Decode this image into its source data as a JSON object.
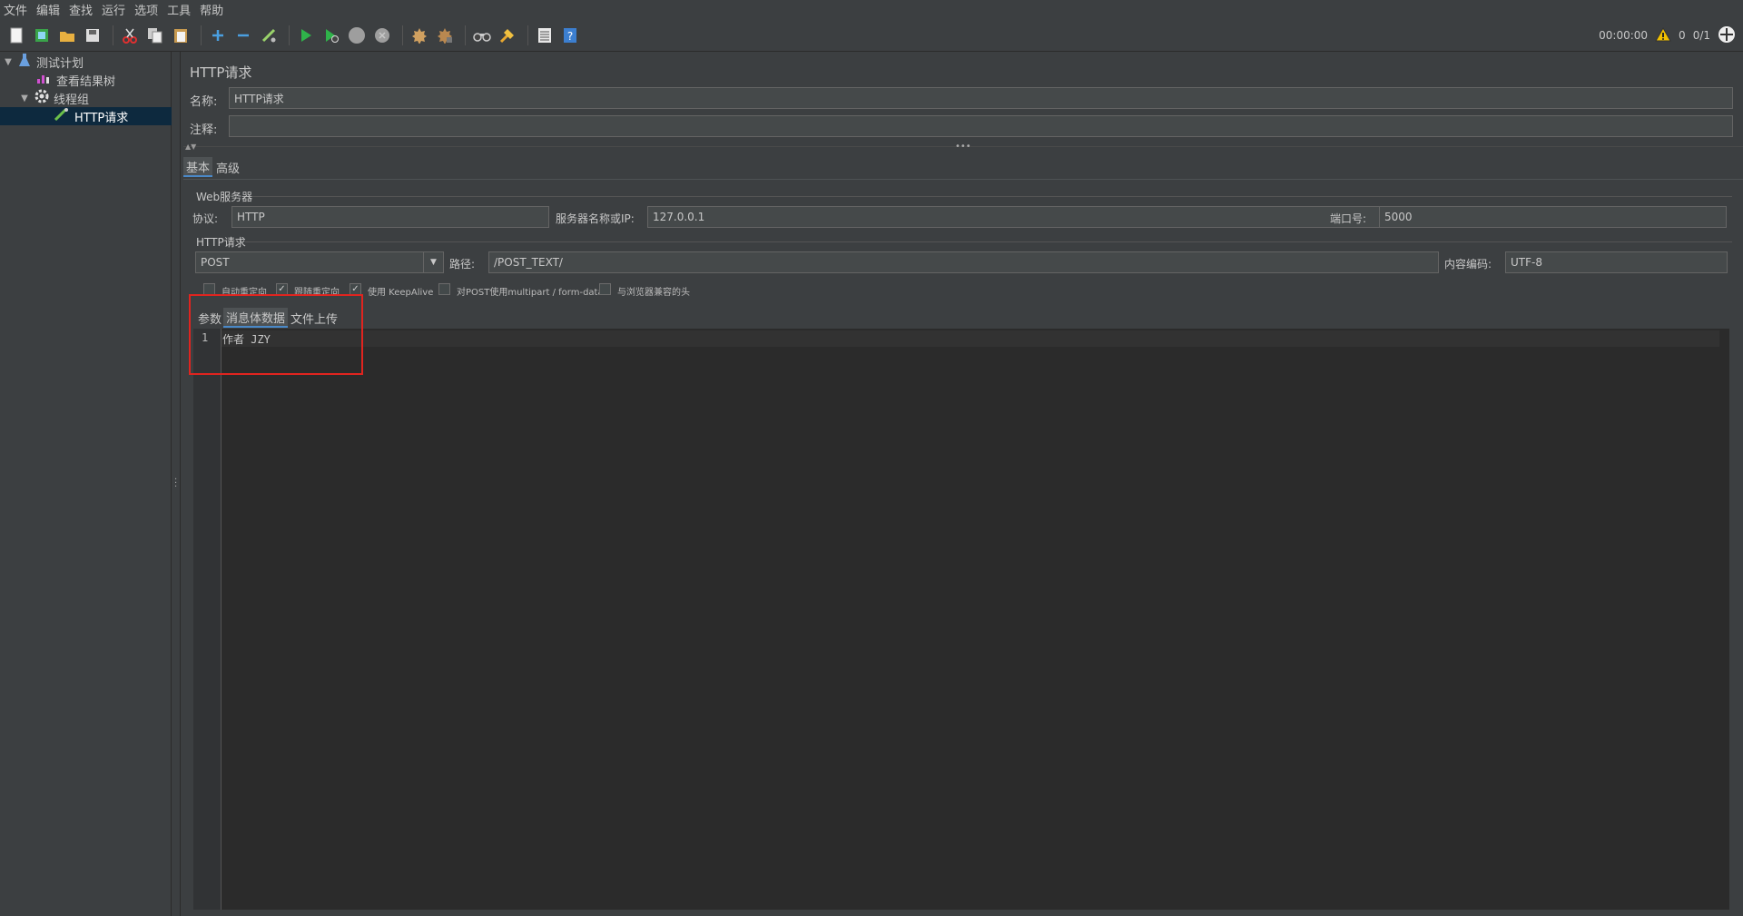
{
  "menu": [
    "文件",
    "编辑",
    "查找",
    "运行",
    "选项",
    "工具",
    "帮助"
  ],
  "toolbar": {
    "icons": [
      "new-icon",
      "templates-icon",
      "open-icon",
      "save-icon",
      "cut-icon",
      "copy-icon",
      "paste-icon",
      "expand-icon",
      "collapse-icon",
      "toggle-icon",
      "start-icon",
      "start-no-pause-icon",
      "stop-icon",
      "shutdown-icon",
      "clear-icon",
      "clear-all-icon",
      "search-icon",
      "reset-search-icon",
      "function-helper-icon",
      "help-icon"
    ],
    "elapsed": "00:00:00",
    "warnings": "0",
    "threads": "0/1"
  },
  "tree": {
    "test_plan": "测试计划",
    "result_tree": "查看结果树",
    "thread_group": "线程组",
    "http_request": "HTTP请求"
  },
  "panel": {
    "title": "HTTP请求",
    "name_label": "名称:",
    "name_value": "HTTP请求",
    "comment_label": "注释:",
    "comment_value": ""
  },
  "tabs": {
    "basic": "基本",
    "advanced": "高级"
  },
  "web_server": {
    "section": "Web服务器",
    "protocol_label": "协议:",
    "protocol_value": "HTTP",
    "server_label": "服务器名称或IP:",
    "server_value": "127.0.0.1",
    "port_label": "端口号:",
    "port_value": "5000"
  },
  "http_request": {
    "section": "HTTP请求",
    "method": "POST",
    "path_label": "路径:",
    "path_value": "/POST_TEXT/",
    "encoding_label": "内容编码:",
    "encoding_value": "UTF-8"
  },
  "options": [
    {
      "label": "自动重定向",
      "checked": false
    },
    {
      "label": "跟随重定向",
      "checked": true
    },
    {
      "label": "使用 KeepAlive",
      "checked": true
    },
    {
      "label": "对POST使用multipart / form-data",
      "checked": false
    },
    {
      "label": "与浏览器兼容的头",
      "checked": false
    }
  ],
  "subtabs": {
    "params": "参数",
    "body": "消息体数据",
    "files": "文件上传"
  },
  "body": {
    "line_number": "1",
    "line_text": "作者 JZY"
  },
  "colors": {
    "highlight_box": "#e0241f",
    "selection": "#0d293e",
    "tab_accent": "#4a88c7"
  }
}
